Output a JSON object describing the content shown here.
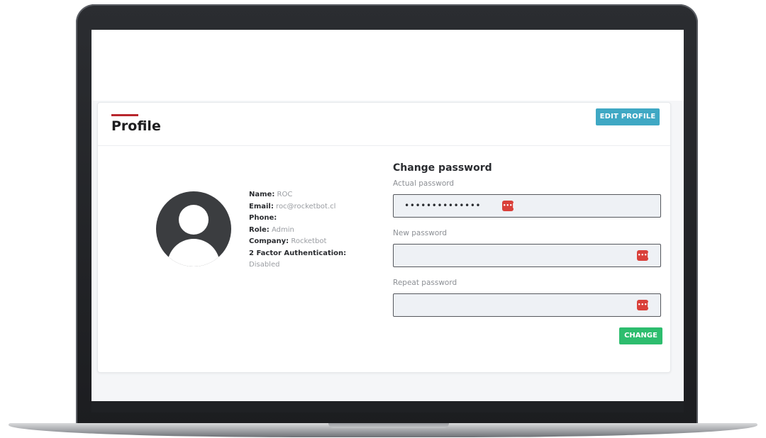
{
  "profile": {
    "title": "Profile",
    "edit_button": "EDIT PROFILE",
    "fields": [
      {
        "label": "Name:",
        "value": "ROC"
      },
      {
        "label": "Email:",
        "value": "roc@rocketbot.cl"
      },
      {
        "label": "Phone:",
        "value": ""
      },
      {
        "label": "Role:",
        "value": "Admin"
      },
      {
        "label": "Company:",
        "value": "Rocketbot"
      },
      {
        "label": "2 Factor Authentication:",
        "value": "Disabled"
      }
    ]
  },
  "change_password": {
    "heading": "Change password",
    "actual_label": "Actual password",
    "actual_value": "••••••••••••••",
    "new_label": "New password",
    "new_value": "",
    "repeat_label": "Repeat password",
    "repeat_value": "",
    "submit": "CHANGE"
  },
  "icons": {
    "avatar": "user-avatar-icon",
    "password_manager": "password-key-icon"
  },
  "colors": {
    "accent_red": "#b8262d",
    "edit_button": "#3fa8c4",
    "change_button": "#2dbd6e",
    "key_badge": "#d9403a"
  }
}
